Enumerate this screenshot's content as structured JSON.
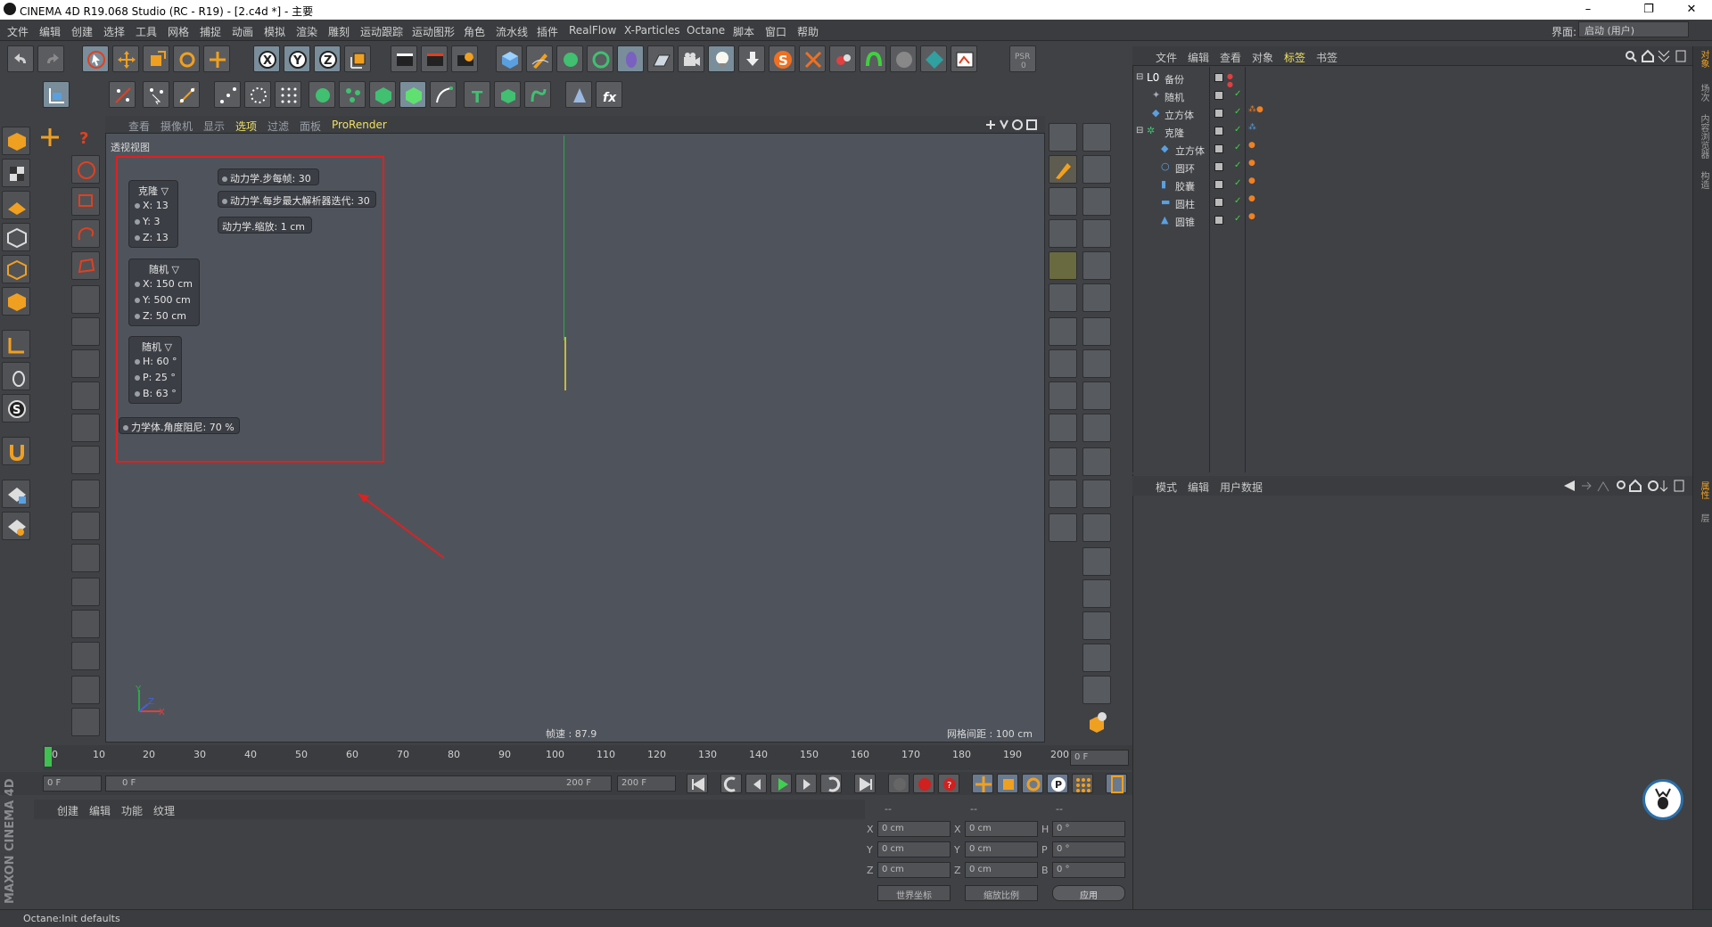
{
  "window": {
    "title": "CINEMA 4D R19.068 Studio (RC - R19) - [2.c4d *] - 主要",
    "min": "–",
    "max": "❐",
    "close": "✕"
  },
  "menu": [
    "文件",
    "编辑",
    "创建",
    "选择",
    "工具",
    "网格",
    "捕捉",
    "动画",
    "模拟",
    "渲染",
    "雕刻",
    "运动跟踪",
    "运动图形",
    "角色",
    "流水线",
    "插件",
    "RealFlow",
    "X-Particles",
    "Octane",
    "脚本",
    "窗口",
    "帮助"
  ],
  "layout": {
    "label": "界面:",
    "value": "启动 (用户)"
  },
  "viewport": {
    "menu": [
      "查看",
      "摄像机",
      "显示",
      "选项",
      "过滤",
      "面板",
      "ProRender"
    ],
    "label": "透视视图",
    "speed": "帧速 : 87.9",
    "grid": "网格间距 : 100 cm",
    "axes": {
      "y": "Y",
      "x": "X",
      "z": "Z"
    }
  },
  "hud": {
    "clone": {
      "title": "克隆",
      "x": "X:   13",
      "y": "Y:   3",
      "z": "Z:   13"
    },
    "random_pos": {
      "title": "随机",
      "x": "X:   150 cm",
      "y": "Y:   500 cm",
      "z": "Z:   50 cm"
    },
    "random_rot": {
      "title": "随机",
      "h": "H:   60 °",
      "p": "P:   25 °",
      "b": "B:   63 °"
    },
    "steps": "动力学.步每帧:   30",
    "maxiter": "动力学.每步最大解析器迭代:   30",
    "scale": "动力学.缩放:   1 cm",
    "angular": "力学体.角度阻尼:   70 %"
  },
  "objects": {
    "menu": [
      "文件",
      "编辑",
      "查看",
      "对象",
      "标签",
      "书签"
    ],
    "rows": [
      {
        "name": "备份",
        "level": 0
      },
      {
        "name": "随机",
        "level": 1
      },
      {
        "name": "立方体",
        "level": 1
      },
      {
        "name": "克隆",
        "level": 0
      },
      {
        "name": "立方体",
        "level": 1
      },
      {
        "name": "圆环",
        "level": 1
      },
      {
        "name": "胶囊",
        "level": 1
      },
      {
        "name": "圆柱",
        "level": 1
      },
      {
        "name": "圆锥",
        "level": 1
      }
    ]
  },
  "attributes": {
    "menu": [
      "模式",
      "编辑",
      "用户数据"
    ]
  },
  "timeline": {
    "ticks": [
      "0",
      "10",
      "20",
      "30",
      "40",
      "50",
      "60",
      "70",
      "80",
      "90",
      "100",
      "110",
      "120",
      "130",
      "140",
      "150",
      "160",
      "170",
      "180",
      "190",
      "200"
    ],
    "current": "0 F",
    "start": "0 F",
    "range_start": "0 F",
    "range_end": "200 F",
    "end": "200 F"
  },
  "materials": {
    "menu": [
      "创建",
      "编辑",
      "功能",
      "纹理"
    ]
  },
  "coords": {
    "headers": [
      "--",
      "--",
      "--"
    ],
    "rows": [
      {
        "a": "X",
        "av": "0 cm",
        "b": "X",
        "bv": "0 cm",
        "c": "H",
        "cv": "0 °"
      },
      {
        "a": "Y",
        "av": "0 cm",
        "b": "Y",
        "bv": "0 cm",
        "c": "P",
        "cv": "0 °"
      },
      {
        "a": "Z",
        "av": "0 cm",
        "b": "Z",
        "bv": "0 cm",
        "c": "B",
        "cv": "0 °"
      }
    ],
    "world": "世界坐标",
    "scale": "缩放比例",
    "apply": "应用"
  },
  "brand": "MAXON CINEMA 4D",
  "status": "Octane:Init defaults",
  "right_tabs": [
    "对象",
    "场次",
    "内容浏览器",
    "构造",
    "属性",
    "层"
  ]
}
